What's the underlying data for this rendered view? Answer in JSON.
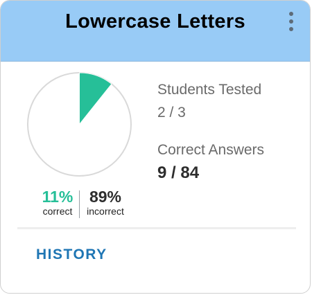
{
  "card": {
    "title": "Lowercase Letters",
    "menu_icon": "vertical-dots-icon"
  },
  "summary": {
    "correct_percent_label": "11%",
    "correct_label": "correct",
    "incorrect_percent_label": "89%",
    "incorrect_label": "incorrect"
  },
  "stats": {
    "students_tested_label": "Students Tested",
    "students_tested_value": "2 / 3",
    "correct_answers_label": "Correct Answers",
    "correct_answers_value": "9 / 84"
  },
  "footer": {
    "history_label": "HISTORY"
  },
  "colors": {
    "header_bg": "#98cbf6",
    "correct": "#26bf98",
    "incorrect": "#ffffff",
    "link": "#1f76b4"
  },
  "chart_data": {
    "type": "pie",
    "categories": [
      "correct",
      "incorrect"
    ],
    "values": [
      9,
      75
    ],
    "percent_labels": [
      "11%",
      "89%"
    ]
  }
}
